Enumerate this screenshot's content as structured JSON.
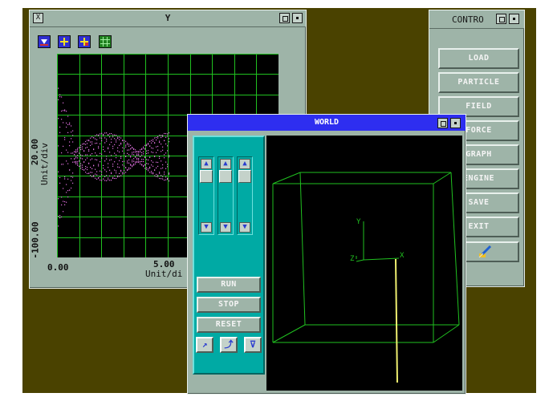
{
  "plot_window": {
    "title": "Y",
    "close_glyph": "X",
    "tools": [
      "select-tool-icon",
      "crosshair-tool-icon",
      "zoom-tool-icon",
      "grid-tool-icon"
    ],
    "y_axis": {
      "top_value": "20.00",
      "bottom_value": "-100.00",
      "unit": "Unit/div"
    },
    "x_axis": {
      "left_value": "0.00",
      "mid_value": "5.00",
      "unit": "Unit/di"
    }
  },
  "control_window": {
    "title": "CONTRO",
    "buttons": [
      "LOAD",
      "PARTICLE",
      "FIELD",
      "FORCE",
      "GRAPH",
      "ENGINE",
      "SAVE",
      "EXIT"
    ],
    "icon_button": "brush-icon"
  },
  "world_window": {
    "title": "WORLD",
    "buttons": {
      "run": "RUN",
      "stop": "STOP",
      "reset": "RESET"
    },
    "small_buttons": [
      "rotate-icon",
      "camera-icon",
      "view-icon"
    ],
    "axes": {
      "x": "X",
      "y": "Y",
      "z": "Z"
    }
  },
  "colors": {
    "desktop": "#4a4200",
    "window": "#9eb4a8",
    "world_titlebar": "#2e2ef0",
    "panel": "#00aaa4",
    "grid": "#20c020",
    "trace": "#e070e0",
    "wireframe": "#20c020",
    "axis_line": "#f0f070"
  }
}
